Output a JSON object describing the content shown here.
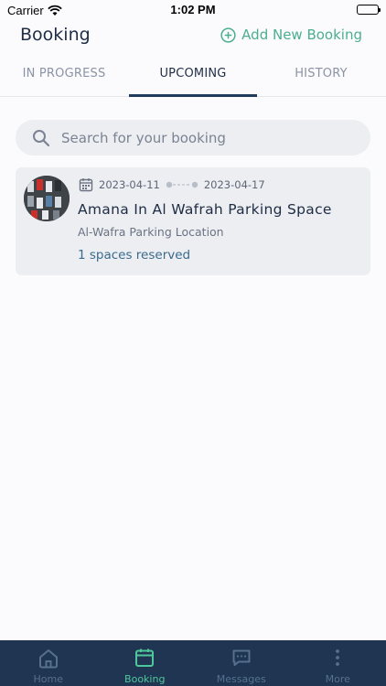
{
  "status_bar": {
    "carrier": "Carrier",
    "time": "1:02 PM"
  },
  "header": {
    "title": "Booking",
    "add_label": "Add New Booking"
  },
  "tabs": [
    {
      "label": "IN PROGRESS"
    },
    {
      "label": "UPCOMING"
    },
    {
      "label": "HISTORY"
    }
  ],
  "search": {
    "placeholder": "Search for your booking"
  },
  "bookings": [
    {
      "start_date": "2023-04-11",
      "end_date": "2023-04-17",
      "title": "Amana In Al Wafrah Parking Space",
      "location": "Al-Wafra Parking Location",
      "spaces": "1 spaces reserved"
    }
  ],
  "bottom_nav": [
    {
      "label": "Home",
      "icon": "home-icon"
    },
    {
      "label": "Booking",
      "icon": "calendar-icon"
    },
    {
      "label": "Messages",
      "icon": "chat-icon"
    },
    {
      "label": "More",
      "icon": "more-vertical-icon"
    }
  ],
  "colors": {
    "accent_green": "#4caf8c",
    "nav_bg": "#1f3552",
    "active_nav": "#4fc79c",
    "text_dark": "#1f2d44"
  }
}
